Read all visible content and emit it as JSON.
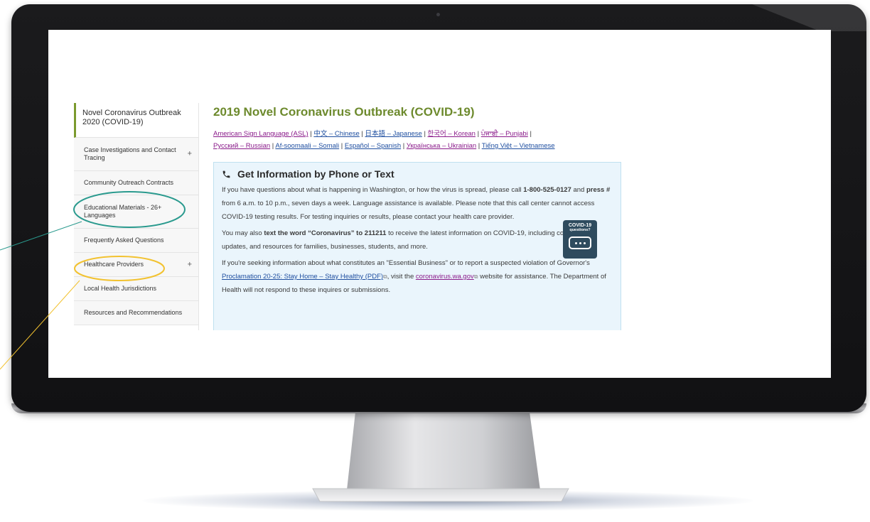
{
  "sidebar": {
    "header": "Novel Coronavirus Outbreak 2020 (COVID-19)",
    "items": [
      {
        "label": "Case Investigations and Contact Tracing",
        "expandable": true
      },
      {
        "label": "Community Outreach Contracts",
        "expandable": false
      },
      {
        "label": "Educational Materials - 26+ Languages",
        "expandable": false
      },
      {
        "label": "Frequently Asked Questions",
        "expandable": false
      },
      {
        "label": "Healthcare Providers",
        "expandable": true
      },
      {
        "label": "Local Health Jurisdictions",
        "expandable": false
      },
      {
        "label": "Resources and Recommendations",
        "expandable": false
      }
    ],
    "plus_symbol": "+"
  },
  "main": {
    "title": "2019 Novel Coronavirus Outbreak (COVID-19)",
    "languages": [
      "American Sign Language (ASL)",
      "中文 – Chinese",
      "日本語 – Japanese",
      "한국어 – Korean",
      "ਪੰਜਾਬੀ – Punjabi",
      "Русский – Russian",
      "Af-soomaali – Somali",
      "Español – Spanish",
      "Українська – Ukrainian",
      "Tiếng Việt – Vietnamese"
    ],
    "separator": "|",
    "info": {
      "title": "Get Information by Phone or Text",
      "p1_a": "If you have questions about what is happening in Washington, or how the virus is spread, please call ",
      "p1_phone": "1-800-525-0127",
      "p1_b": " and ",
      "p1_press": "press #",
      "p1_c": " from 6 a.m. to 10 p.m., seven days a week. Language assistance is available. Please note that this call center cannot access COVID-19 testing results. For testing inquiries or results, please contact your health care provider.",
      "p2_a": "You may also ",
      "p2_bold": "text the word “Coronavirus” to 211211",
      "p2_b": " to receive the latest information on COVID-19, including county-level updates, and resources for families, businesses, students, and more.",
      "p3_a": "If you're seeking information about what constitutes an \"Essential Business\" or to report a suspected violation of Governor's ",
      "p3_link1": "Proclamation 20-25: Stay Home – Stay Healthy (PDF)",
      "p3_b": ", visit the ",
      "p3_link2": "coronavirus.wa.gov",
      "p3_c": " website for assistance. The Department of Health will not respond to these inquires or submissions."
    },
    "badge": {
      "line1": "COVID-19",
      "line2": "questions?"
    }
  },
  "colors": {
    "title_green": "#6d8a2d",
    "link_blue": "#1f4fa0",
    "link_purple": "#8a1a8a",
    "info_bg": "#eaf5fc",
    "badge_bg": "#2e4b5e",
    "annotation_teal": "#2a9a8e",
    "annotation_yellow": "#f2c230"
  }
}
